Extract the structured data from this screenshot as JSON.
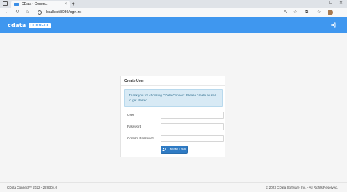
{
  "browser": {
    "tab_title": "CData - Connect",
    "tab_close": "×",
    "new_tab": "+",
    "url": "localhost:8080/login.rst",
    "window_controls": {
      "minimize": "–",
      "maximize": "☐",
      "close": "✕"
    },
    "nav": {
      "back": "←",
      "reload": "↻",
      "home": "⌂"
    },
    "tools": {
      "read_aloud": "A",
      "favorites": "☆",
      "extensions": "⧉",
      "collections": "☆",
      "menu": "···"
    }
  },
  "header": {
    "logo_text": "cdata",
    "logo_badge": "CONNECT",
    "login_icon": "icon-login",
    "brand_color": "#3f97ef"
  },
  "card": {
    "title": "Create User",
    "info_message": "Thank you for choosing CData Connect. Please create a user to get started.",
    "fields": {
      "user_label": "User",
      "user_value": "",
      "password_label": "Password",
      "password_value": "",
      "confirm_label": "Confirm Password",
      "confirm_value": ""
    },
    "submit_label": "Create User",
    "submit_icon": "add-user-icon"
  },
  "footer": {
    "version": "CData Connect™ 2022 - 22.8304.0",
    "copyright": "© 2023 CData Software, Inc. - All Rights Reserved."
  }
}
